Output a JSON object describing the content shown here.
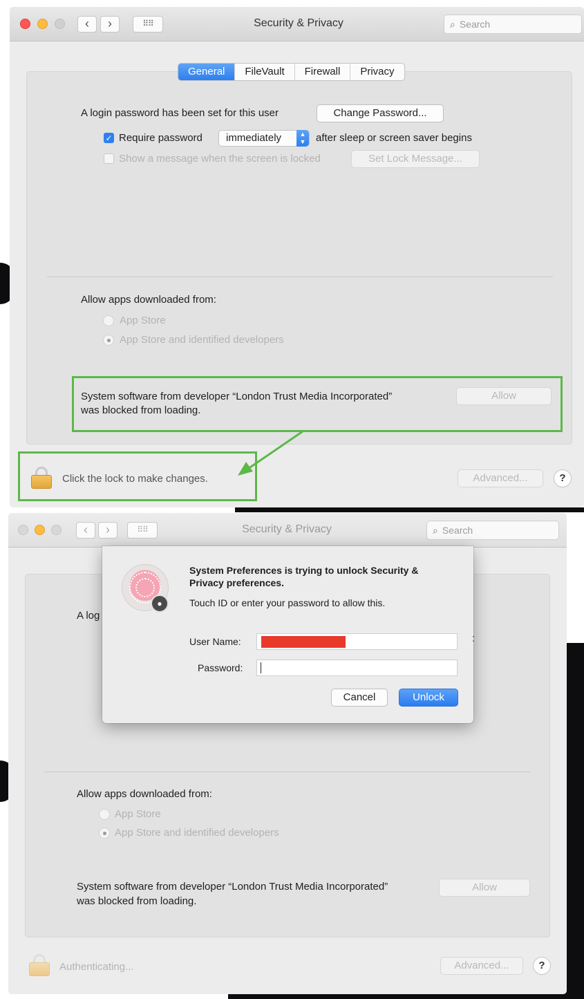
{
  "colors": {
    "accent": "#2f7ff2",
    "highlight": "#5cb848",
    "redaction": "#e8392b"
  },
  "window": {
    "title": "Security & Privacy",
    "search_placeholder": "Search",
    "nav_back": "‹",
    "nav_forward": "›",
    "grid_icon": "⠿⠿"
  },
  "tabs": [
    "General",
    "FileVault",
    "Firewall",
    "Privacy"
  ],
  "general": {
    "login_text": "A login password has been set for this user",
    "change_password": "Change Password...",
    "require_password_label": "Require password",
    "require_password_value": "immediately",
    "after_sleep_text": "after sleep or screen saver begins",
    "show_message_label": "Show a message when the screen is locked",
    "set_lock_message": "Set Lock Message..."
  },
  "allow_apps": {
    "heading": "Allow apps downloaded from:",
    "options": [
      "App Store",
      "App Store and identified developers"
    ],
    "selected": "App Store and identified developers"
  },
  "blocked": {
    "line1": "System software from developer “London Trust Media Incorporated”",
    "line2": "was blocked from loading.",
    "allow_button": "Allow"
  },
  "footer": {
    "lock_text_top": "Click the lock to make changes.",
    "lock_text_bottom": "Authenticating...",
    "advanced": "Advanced...",
    "help": "?"
  },
  "dialog": {
    "title": "System Preferences is trying to unlock Security & Privacy preferences.",
    "title_line1": "System Preferences is trying to unlock Security &",
    "title_line2": "Privacy preferences.",
    "message": "Touch ID or enter your password to allow this.",
    "username_label": "User Name:",
    "password_label": "Password:",
    "cancel": "Cancel",
    "unlock": "Unlock"
  },
  "partial_text": {
    "login_fragment": "A log"
  }
}
